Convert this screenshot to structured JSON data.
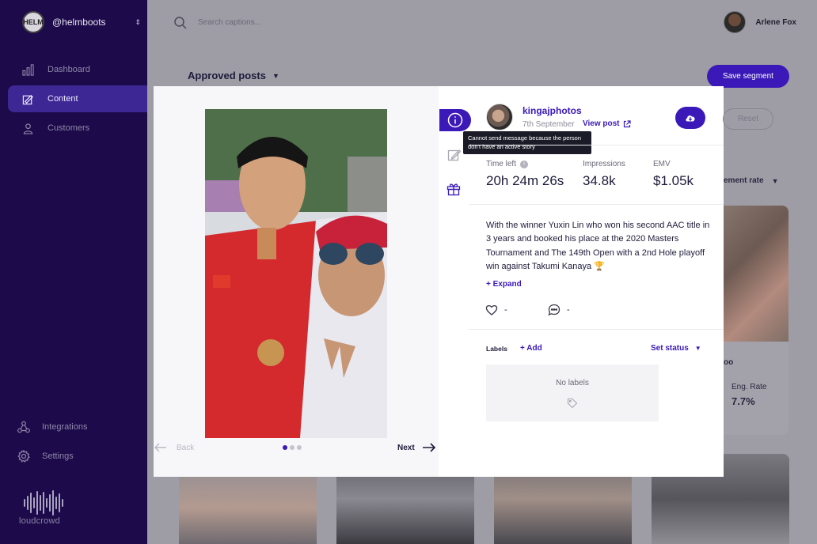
{
  "sidebar": {
    "account": {
      "logo_text": "HELM",
      "handle": "@helmboots"
    },
    "nav": [
      {
        "label": "Dashboard",
        "icon": "chart-icon",
        "active": false
      },
      {
        "label": "Content",
        "icon": "content-icon",
        "active": true
      },
      {
        "label": "Customers",
        "icon": "user-icon",
        "active": false
      }
    ],
    "bottom": [
      {
        "label": "Integrations",
        "icon": "integrations-icon"
      },
      {
        "label": "Settings",
        "icon": "gear-icon"
      }
    ],
    "brand": "loudcrowd"
  },
  "topbar": {
    "search_placeholder": "Search captions...",
    "user_name": "Arlene Fox"
  },
  "page": {
    "heading": "Approved posts",
    "save_segment_label": "Save segment",
    "reset_label": "Reset",
    "sort_partial": "ement rate"
  },
  "background_card": {
    "handle_partial": "oo",
    "eng_label": "Eng. Rate",
    "eng_value": "7.7%"
  },
  "modal": {
    "nav": {
      "back_label": "Back",
      "next_label": "Next",
      "slides": 3,
      "current_slide": 1
    },
    "tooltip": "Cannot send message because the person don't have an active story",
    "post": {
      "username": "kingajphotos",
      "date": "7th September",
      "view_post_label": "View post",
      "stats": [
        {
          "label": "Time left",
          "value": "20h 24m 26s",
          "info": true
        },
        {
          "label": "Impressions",
          "value": "34.8k",
          "info": false
        },
        {
          "label": "EMV",
          "value": "$1.05k",
          "info": false
        }
      ],
      "caption": "With the winner Yuxin Lin who won his second AAC title in 3 years and booked his place at the 2020 Masters Tournament and The 149th Open with a 2nd Hole playoff win against Takumi Kanaya 🏆",
      "expand_label": "+ Expand",
      "likes": "-",
      "comments": "-",
      "labels_title": "Labels",
      "add_label": "+ Add",
      "set_status_label": "Set status",
      "no_labels_text": "No labels"
    }
  },
  "colors": {
    "accent": "#3a19b8",
    "sidebar_bg": "#1c0a4a",
    "sidebar_active": "#3c2795"
  }
}
